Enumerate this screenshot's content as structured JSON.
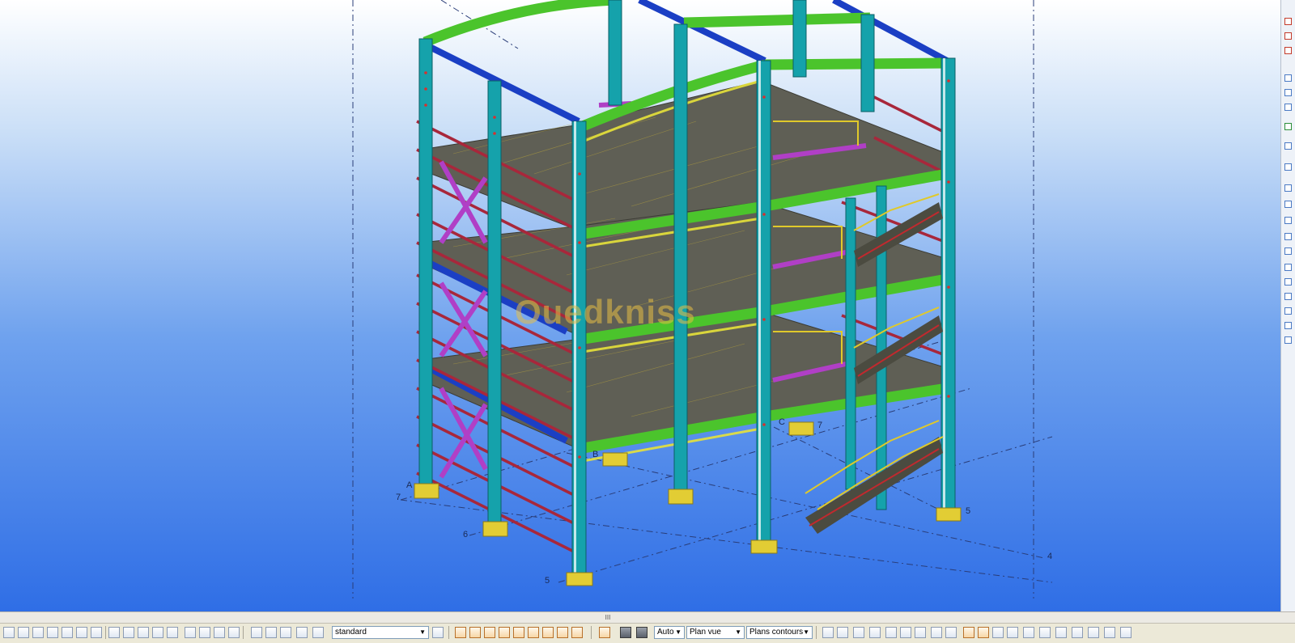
{
  "viewport": {
    "grid_labels": {
      "axis_a": "A",
      "axis_b": "B",
      "axis_c": "C",
      "row_7_left": "7",
      "row_7_mid": "7",
      "row_6": "6",
      "row_5_front": "5",
      "row_5_right": "5",
      "row_4": "4"
    },
    "watermark": "Ouedkniss",
    "colors": {
      "column": "#159fa8",
      "beam_main": "#4cc92c",
      "purlin": "#1b3fc4",
      "bracing": "#b23fc4",
      "girt": "#b52a3e",
      "floor": "#6b6b5e",
      "base_plate": "#e4d034",
      "stair": "#d8c028"
    }
  },
  "scrollbar": {
    "thumb_label": "III"
  },
  "toolbar": {
    "filter_value": "standard",
    "mode_value": "Auto",
    "view_value": "Plan vue",
    "plane_value": "Plans contours"
  }
}
